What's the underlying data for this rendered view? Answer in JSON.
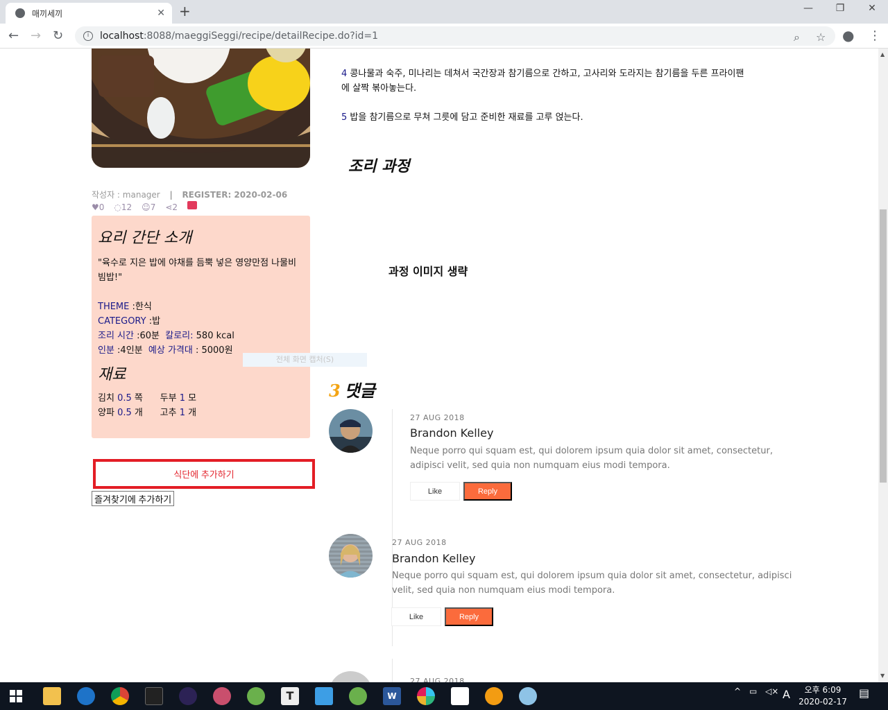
{
  "browser": {
    "tab_title": "매끼세끼",
    "url_host": "localhost",
    "url_rest": ":8088/maeggiSeggi/recipe/detailRecipe.do?id=1"
  },
  "recipe": {
    "author_label": "작성자 : manager",
    "register_label": "REGISTER: 2020-02-06",
    "stats": {
      "likes": "0",
      "comments": "12",
      "views": "7",
      "shares": "2"
    },
    "intro_title": "요리 간단 소개",
    "intro_text": "\"육수로 지은 밥에 야채를 듬뿍 넣은 영양만점 나물비빔밥!\"",
    "theme_label": "THEME",
    "theme_value": " :한식",
    "category_label": "CATEGORY",
    "category_value": " :밥",
    "time_label": "조리 시간",
    "time_value": " :60분",
    "calorie_label": "칼로리:",
    "calorie_value": " 580 kcal",
    "serving_label": "인분",
    "serving_value": " :4인분",
    "price_label": "예상 가격대",
    "price_value": " : 5000원",
    "ingredients_title": "재료",
    "ingredients": [
      {
        "name": "김치",
        "amount": "0.5",
        "unit": "쪽"
      },
      {
        "name": "두부",
        "amount": "1",
        "unit": "모"
      },
      {
        "name": "양파",
        "amount": "0.5",
        "unit": "개"
      },
      {
        "name": "고추",
        "amount": "1",
        "unit": "개"
      }
    ],
    "add_diet_button": "식단에 추가하기",
    "add_fav_button": "즐겨찾기에 추가하기"
  },
  "steps": [
    {
      "num": "4",
      "text": "콩나물과 숙주, 미나리는 데쳐서 국간장과 참기름으로 간하고, 고사리와 도라지는 참기름을 두른 프라이팬",
      "cont": "에 살짝 볶아놓는다."
    },
    {
      "num": "5",
      "text": "밥을 참기름으로 무쳐 그릇에 담고 준비한 재료를 고루 얹는다."
    }
  ],
  "process_title": "조리 과정",
  "process_omitted": "과정 이미지 생략",
  "ghost_text": "전체 화면 캡처(S)",
  "comments_count": "3",
  "comments_title": "댓글",
  "comments": [
    {
      "date": "27 AUG 2018",
      "name": "Brandon Kelley",
      "text1": "Neque porro qui squam est, qui dolorem ipsum quia dolor sit amet, consectetur,",
      "text2": "adipisci velit, sed quia non numquam eius modi tempora.",
      "like": "Like",
      "reply": "Reply"
    },
    {
      "date": "27 AUG 2018",
      "name": "Brandon Kelley",
      "text1": "Neque porro qui squam est, qui dolorem ipsum quia dolor sit amet, consectetur, adipisci",
      "text2": "velit, sed quia non numquam eius modi tempora.",
      "like": "Like",
      "reply": "Reply"
    },
    {
      "date": "27 AUG 2018"
    }
  ],
  "taskbar": {
    "time": "오후 6:09",
    "date": "2020-02-17",
    "ime": "A"
  }
}
